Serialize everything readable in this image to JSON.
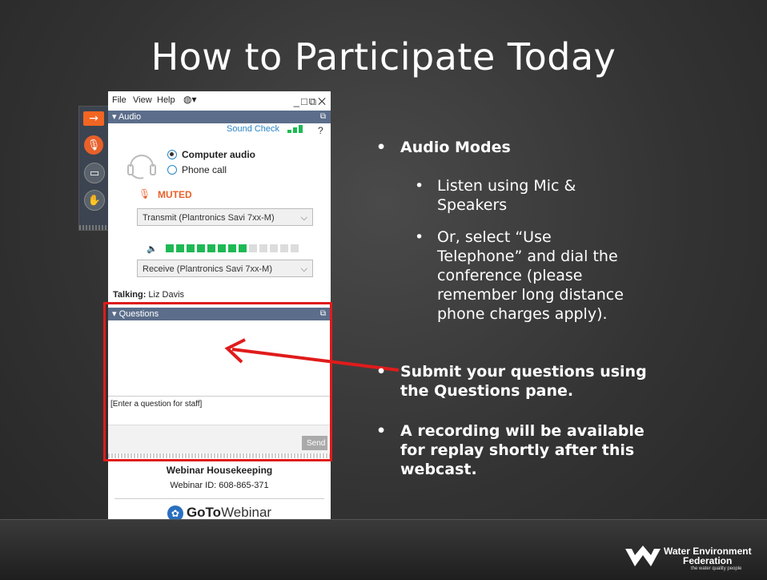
{
  "slide": {
    "title": "How to Participate Today",
    "bullets": [
      "Audio Modes",
      "Listen using Mic & Speakers",
      "Or, select “Use Telephone” and dial the conference (please remember long distance phone charges apply).",
      "Submit your questions using the Questions pane.",
      "A recording will be available for replay shortly after this webcast."
    ],
    "bullet_lines": {
      "b2": [
        "Listen using Mic &",
        "Speakers"
      ],
      "b3": [
        "Or, select “Use",
        "Telephone” and dial the",
        "conference (please",
        "remember long distance",
        "phone charges apply)."
      ],
      "b4": [
        "Submit your questions using",
        "the Questions pane."
      ],
      "b5": [
        "A recording will be available",
        "for replay shortly after this",
        "webcast."
      ]
    },
    "bullet_glyph": "•",
    "logo": {
      "line1": "Water Environment",
      "line2": "Federation",
      "tagline": "the water quality people"
    }
  },
  "panel": {
    "menu": {
      "file": "File",
      "view": "View",
      "help": "Help",
      "globe": "◍▾",
      "controls": "_□⧉✕"
    },
    "audio": {
      "section_label": "▾ Audio",
      "sound_check": "Sound Check",
      "help": "?",
      "computer_audio": "Computer audio",
      "phone_call": "Phone call",
      "muted": "MUTED",
      "transmit": "Transmit (Plantronics Savi 7xx-M)",
      "receive": "Receive (Plantronics Savi 7xx-M)",
      "meter_level": 0.6,
      "talking_label": "Talking:",
      "talking_name": "Liz Davis"
    },
    "questions": {
      "section_label": "▾ Questions",
      "placeholder": "[Enter a question for staff]",
      "send": "Send"
    },
    "housekeeping": {
      "title": "Webinar Housekeeping",
      "id": "Webinar ID: 608-865-371"
    },
    "brand": {
      "goto": "GoTo",
      "webinar": "Webinar"
    },
    "chevron": "⌵",
    "popout": "⧉"
  },
  "colors": {
    "accent_orange": "#e8602a",
    "highlight_red": "#e01b1b",
    "section_blue": "#5b6d8a",
    "meter_green": "#1db954"
  }
}
